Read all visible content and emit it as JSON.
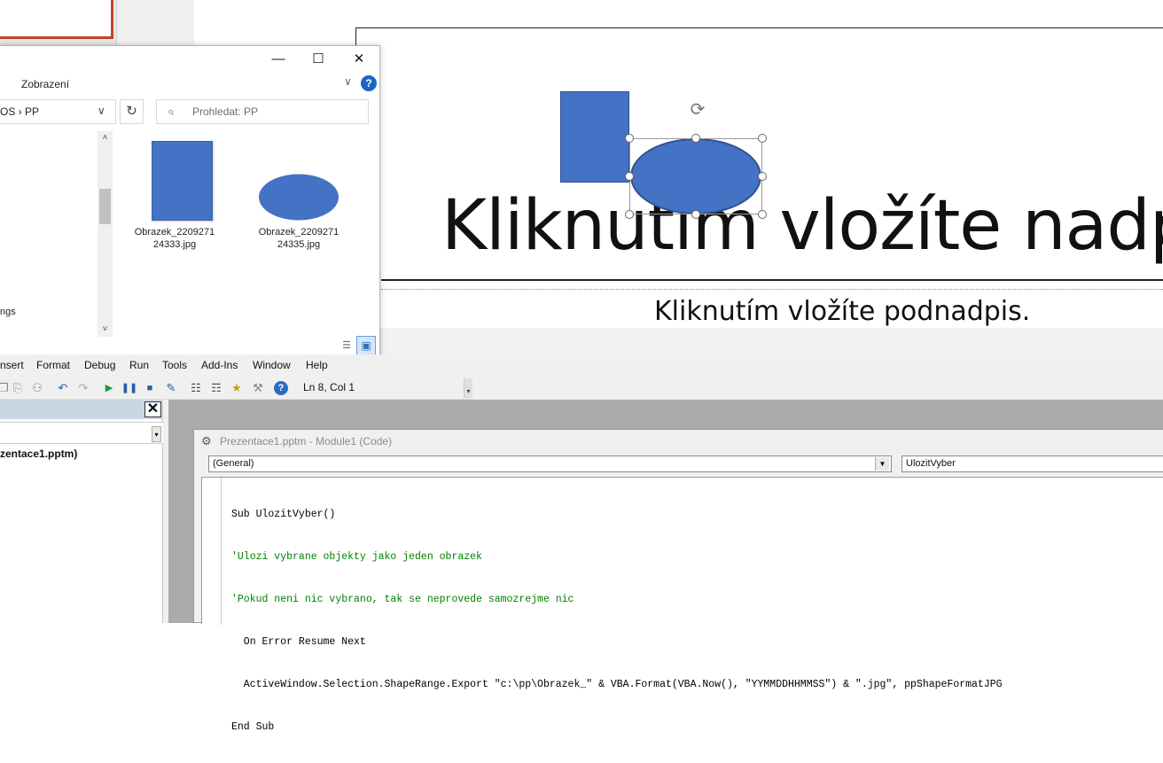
{
  "ppt": {
    "slide_title": "Kliknutím vložíte nadp",
    "slide_subtitle": "Kliknutím vložíte podnadpis.",
    "shape_color": "#4472c4"
  },
  "explorer": {
    "ribbon_tab": "Zobrazení",
    "address_visible": "OS  ›  PP",
    "search_placeholder": "Prohledat: PP",
    "nav_partial_label": "ngs",
    "files": [
      {
        "name_line1": "Obrazek_2209271",
        "name_line2": "24333.jpg",
        "shape": "rectangle"
      },
      {
        "name_line1": "Obrazek_2209271",
        "name_line2": "24335.jpg",
        "shape": "ellipse"
      }
    ]
  },
  "vbe": {
    "menu": [
      "nsert",
      "Format",
      "Debug",
      "Run",
      "Tools",
      "Add-Ins",
      "Window",
      "Help"
    ],
    "toolbar_position": "Ln 8, Col 1",
    "project_item": "zentace1.pptm)",
    "code_window_title": "Prezentace1.pptm - Module1 (Code)",
    "object_combo": "(General)",
    "procedure_combo": "UlozitVyber",
    "code": [
      {
        "text": "Sub UlozitVyber()",
        "kind": "plain"
      },
      {
        "text": "'Ulozi vybrane objekty jako jeden obrazek",
        "kind": "comment"
      },
      {
        "text": "'Pokud neni nic vybrano, tak se neprovede samozrejme nic",
        "kind": "comment"
      },
      {
        "text": "  On Error Resume Next",
        "kind": "plain"
      },
      {
        "text": "  ActiveWindow.Selection.ShapeRange.Export \"c:\\pp\\Obrazek_\" & VBA.Format(VBA.Now(), \"YYMMDDHHMMSS\") & \".jpg\", ppShapeFormatJPG",
        "kind": "plain"
      },
      {
        "text": "End Sub",
        "kind": "plain"
      }
    ]
  }
}
